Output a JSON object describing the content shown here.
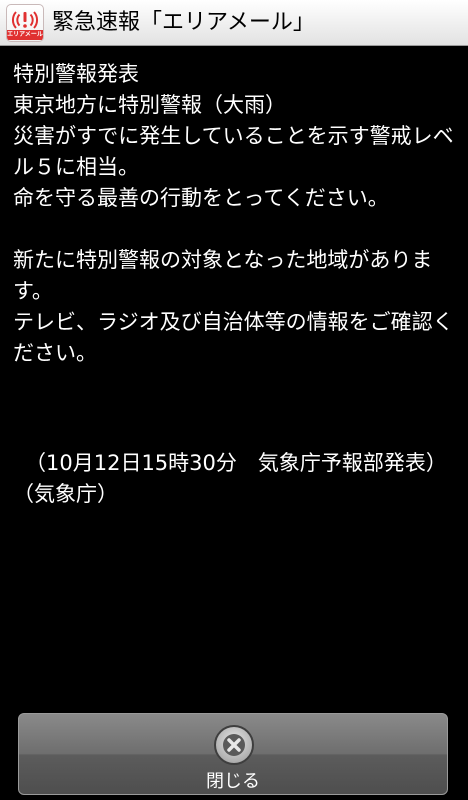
{
  "header": {
    "title": "緊急速報「エリアメール」",
    "app_icon_label": "エリアメール",
    "app_icon": "emergency-alert-icon",
    "background": "#e8e8e8"
  },
  "message": {
    "lines": [
      "特別警報発表",
      "東京地方に特別警報（大雨）",
      "災害がすでに発生していることを示す警戒レベル５に相当。",
      "命を守る最善の行動をとってください。",
      "新たに特別警報の対象となった地域があります。",
      "テレビ、ラジオ及び自治体等の情報をご確認ください。",
      "（10月12日15時30分　気象庁予報部発表）",
      "（気象庁）"
    ]
  },
  "footer": {
    "close_label": "閉じる",
    "close_icon": "close-icon"
  },
  "colors": {
    "background": "#000000",
    "text": "#ffffff",
    "alert_red": "#e03030",
    "button": "#6e6e6e"
  }
}
